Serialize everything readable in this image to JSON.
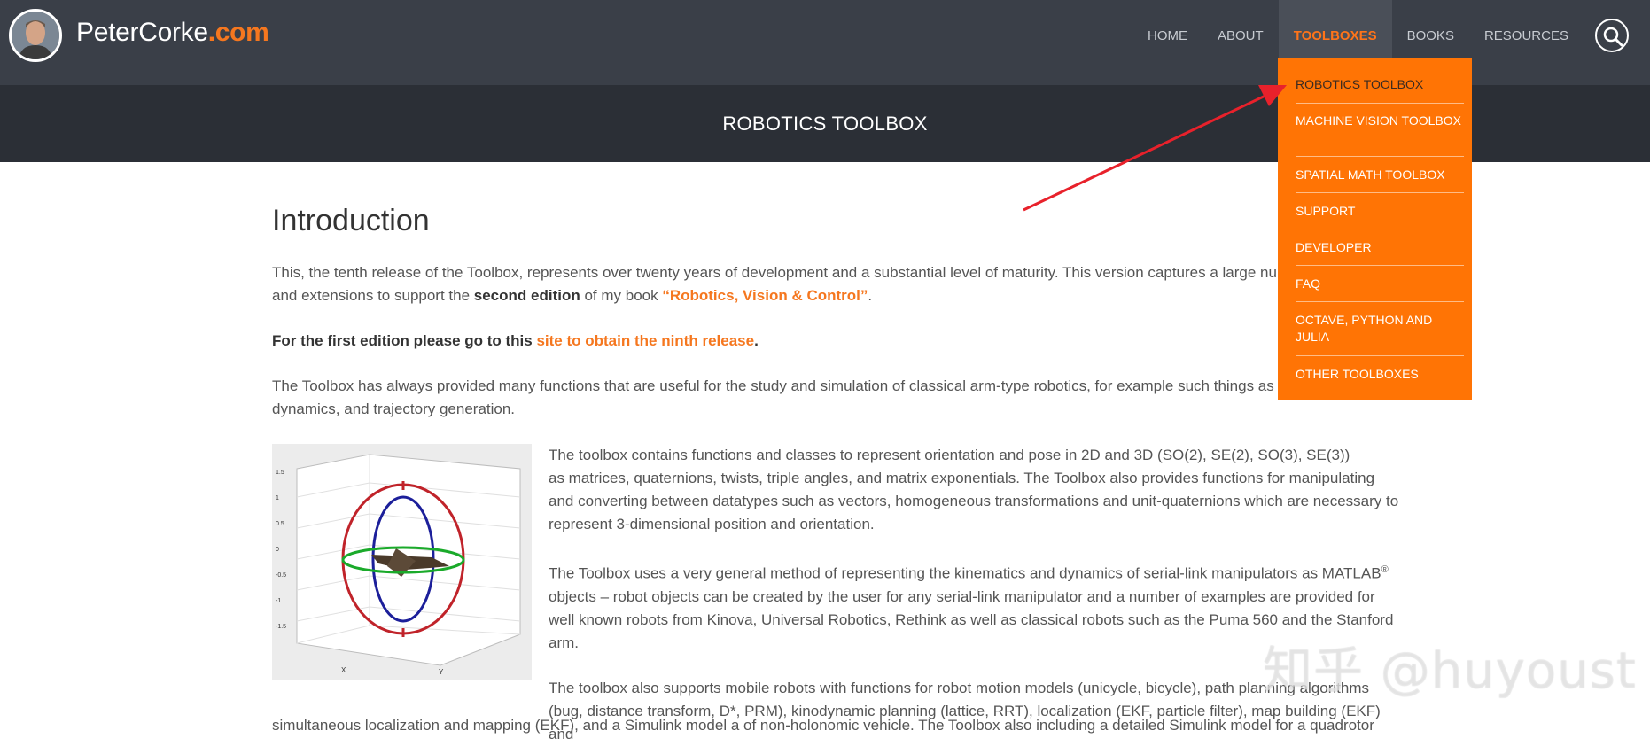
{
  "site": {
    "logo_name": "PeterCorke",
    "logo_tld": ".com"
  },
  "nav": {
    "items": [
      {
        "label": "HOME"
      },
      {
        "label": "ABOUT"
      },
      {
        "label": "TOOLBOXES"
      },
      {
        "label": "BOOKS"
      },
      {
        "label": "RESOURCES"
      }
    ],
    "active_index": 2,
    "search_icon": "search-icon"
  },
  "dropdown": {
    "items": [
      {
        "label": "ROBOTICS TOOLBOX"
      },
      {
        "label": "MACHINE VISION TOOLBOX"
      },
      {
        "label": "SPATIAL MATH TOOLBOX"
      },
      {
        "label": "SUPPORT"
      },
      {
        "label": "DEVELOPER"
      },
      {
        "label": "FAQ"
      },
      {
        "label": "OCTAVE, PYTHON AND JULIA"
      },
      {
        "label": "OTHER TOOLBOXES"
      }
    ]
  },
  "page": {
    "title": "ROBOTICS TOOLBOX",
    "heading": "Introduction",
    "p1_a": "This, the tenth release of the Toolbox, represents over twenty years of development and a substantial level of maturity.  This version captures a large numbe",
    "p1_b": "and extensions to support the ",
    "p1_bold": "second edition",
    "p1_c": " of my book ",
    "p1_link": "“Robotics, Vision & Control”",
    "p1_d": ".",
    "p2_bold": "For the first edition please go to this ",
    "p2_link": "site to obtain the ninth release",
    "p2_end": ".",
    "p3_a": "The Toolbox has always provided many functions that are useful for the study and simulation of classical arm-type robotics, for example such things as kine",
    "p3_b": "dynamics, and  trajectory generation.",
    "p4_1": "The toolbox contains functions and classes to represent orientation and pose in 2D and 3D (SO(2), SE(2), SO(3), SE(3))",
    "p4_2": "as matrices, quaternions, twists, triple angles, and matrix exponentials. The Toolbox also provides functions for manipulating",
    "p4_3": "and converting between datatypes such as vectors, homogeneous transformations and unit-quaternions which are necessary to",
    "p4_4": "represent 3-dimensional position and orientation.",
    "p5_1a": "The Toolbox uses a very general method of representing the kinematics and dynamics of serial-link manipulators as MATLAB",
    "p5_sup": "®",
    "p5_2": "objects –  robot objects can be created by the user for any serial-link manipulator and a number of examples are provided for",
    "p5_3": "well known robots from Kinova, Universal Robotics, Rethink as well as classical robots such as the Puma 560 and the Stanford",
    "p5_4": "arm.",
    "p6_1": "The toolbox also supports mobile robots with functions for robot motion models (unicycle, bicycle), path planning algorithms",
    "p6_2": "(bug, distance transform, D*, PRM), kinodynamic planning (lattice, RRT), localization (EKF, particle filter), map building (EKF) and",
    "p6_3": "simultaneous localization and mapping (EKF), and a Simulink model a of non-holonomic vehicle.  The Toolbox also including a detailed Simulink model for a quadrotor"
  },
  "figure": {
    "tick_labels": [
      "1.5",
      "1",
      "0.5",
      "0",
      "-0.5",
      "-1",
      "-1.5"
    ],
    "axis_x": "X",
    "axis_y": "Y"
  },
  "watermark": "知乎 @huyoust",
  "colors": {
    "accent": "#f5771f",
    "header_bg": "#3a3f48",
    "band_bg": "#2b2f36",
    "dropdown_bg": "#ff7405",
    "arrow": "#e8212b"
  }
}
